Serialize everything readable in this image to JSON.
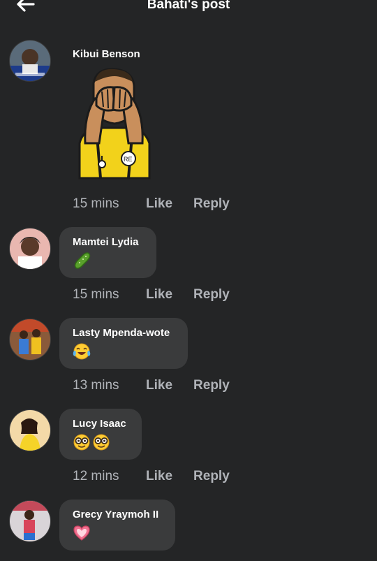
{
  "header": {
    "title": "Bahati's post",
    "back_icon": "back-arrow-icon"
  },
  "comments": [
    {
      "author": "Kibui Benson",
      "content": "sticker",
      "sticker_icon": "face-palm-referee-sticker",
      "time": "15 mins",
      "like_label": "Like",
      "reply_label": "Reply"
    },
    {
      "author": "Mamtei Lydia",
      "emojis": [
        "cucumber-icon"
      ],
      "time": "15 mins",
      "like_label": "Like",
      "reply_label": "Reply"
    },
    {
      "author": "Lasty Mpenda-wote",
      "emojis": [
        "tears-of-joy-icon"
      ],
      "time": "13 mins",
      "like_label": "Like",
      "reply_label": "Reply"
    },
    {
      "author": "Lucy Isaac",
      "emojis": [
        "nerd-face-icon",
        "nerd-face-icon"
      ],
      "time": "12 mins",
      "like_label": "Like",
      "reply_label": "Reply"
    },
    {
      "author": "Grecy Yraymoh II",
      "emojis": [
        "heart-icon"
      ],
      "time": "",
      "like_label": "",
      "reply_label": ""
    }
  ],
  "colors": {
    "background": "#242526",
    "bubble": "#3a3b3c",
    "meta_text": "#b0b3b8",
    "name_text": "#ffffff"
  }
}
